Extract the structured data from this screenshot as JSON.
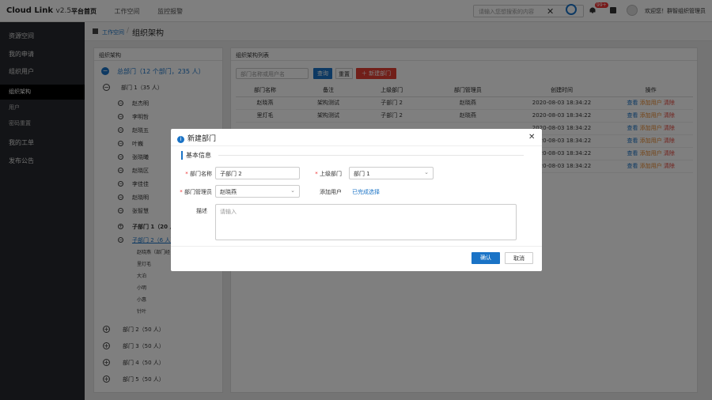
{
  "brand": {
    "name": "Cloud Link",
    "version": "v2.5"
  },
  "topnav": [
    "平台首页",
    "工作空间",
    "监控报警"
  ],
  "search": {
    "placeholder": "请输入您想搜索的内容"
  },
  "notifications": {
    "count": "99+"
  },
  "user": {
    "welcome": "欢迎您！群智组织管理员"
  },
  "sidebar": [
    {
      "label": "资源空间"
    },
    {
      "label": "我的申请"
    },
    {
      "label": "组织用户"
    },
    {
      "label": "组织架构"
    },
    {
      "label": "用户"
    },
    {
      "label": "密码重置"
    },
    {
      "label": "我的工单"
    },
    {
      "label": "发布公告"
    }
  ],
  "breadcrumb": {
    "parent": "工作空间",
    "current": "组织架构"
  },
  "tree": {
    "title": "组织架构",
    "root": "总部门（12 个部门，235 人）",
    "dept1": "部门 1（35 人）",
    "members": [
      "赵杰明",
      "李明哲",
      "赵晓五",
      "叶巍",
      "张晓曦",
      "赵晓区",
      "李佳佳",
      "赵晓明",
      "张智慧"
    ],
    "sub1": "子部门 1（20 人）",
    "sub2": "子部门 2（6 人）",
    "sub2_members": [
      "赵晓燕（部门经",
      "里灯毛",
      "大泊",
      "小明",
      "小惠",
      "针叶"
    ],
    "depts": [
      "部门 2（50 人）",
      "部门 3（50 人）",
      "部门 4（50 人）",
      "部门 5（50 人）"
    ]
  },
  "list": {
    "title": "组织架构列表",
    "filter_placeholder": "部门名称或用户名",
    "query_btn": "查询",
    "reset_btn": "重置",
    "new_btn": "新建部门",
    "headers": [
      "部门名称",
      "备注",
      "上级部门",
      "部门管理员",
      "创建时间",
      "操作"
    ],
    "rows": [
      [
        "赵晓燕",
        "架构测试",
        "子部门 2",
        "赵晓燕",
        "2020-08-03 18:34:22"
      ],
      [
        "里灯毛",
        "架构测试",
        "子部门 2",
        "赵晓燕",
        "2020-08-03 18:34:22"
      ],
      [
        "",
        "",
        "",
        "",
        "2020-08-03 18:34:22"
      ],
      [
        "",
        "",
        "",
        "",
        "2020-08-03 18:34:22"
      ],
      [
        "",
        "",
        "",
        "",
        "2020-08-03 18:34:22"
      ],
      [
        "",
        "",
        "",
        "",
        "2020-08-03 18:34:22"
      ]
    ],
    "actions": [
      "查看",
      "添加用户",
      "清除"
    ]
  },
  "modal": {
    "title": "新建部门",
    "section": "基本信息",
    "dept_name_label": "部门名称",
    "dept_name_value": "子部门 2",
    "parent_label": "上级部门",
    "parent_value": "部门 1",
    "manager_label": "部门管理员",
    "manager_value": "赵晓燕",
    "add_user_label": "添加用户",
    "add_user_link": "已完成选择",
    "desc_label": "描述",
    "desc_placeholder": "请输入",
    "ok": "确认",
    "cancel": "取消"
  },
  "colors": {
    "primary": "#1a73c6",
    "danger": "#e33e33",
    "sidebar": "#27292e",
    "action_orange": "#e8862a"
  }
}
